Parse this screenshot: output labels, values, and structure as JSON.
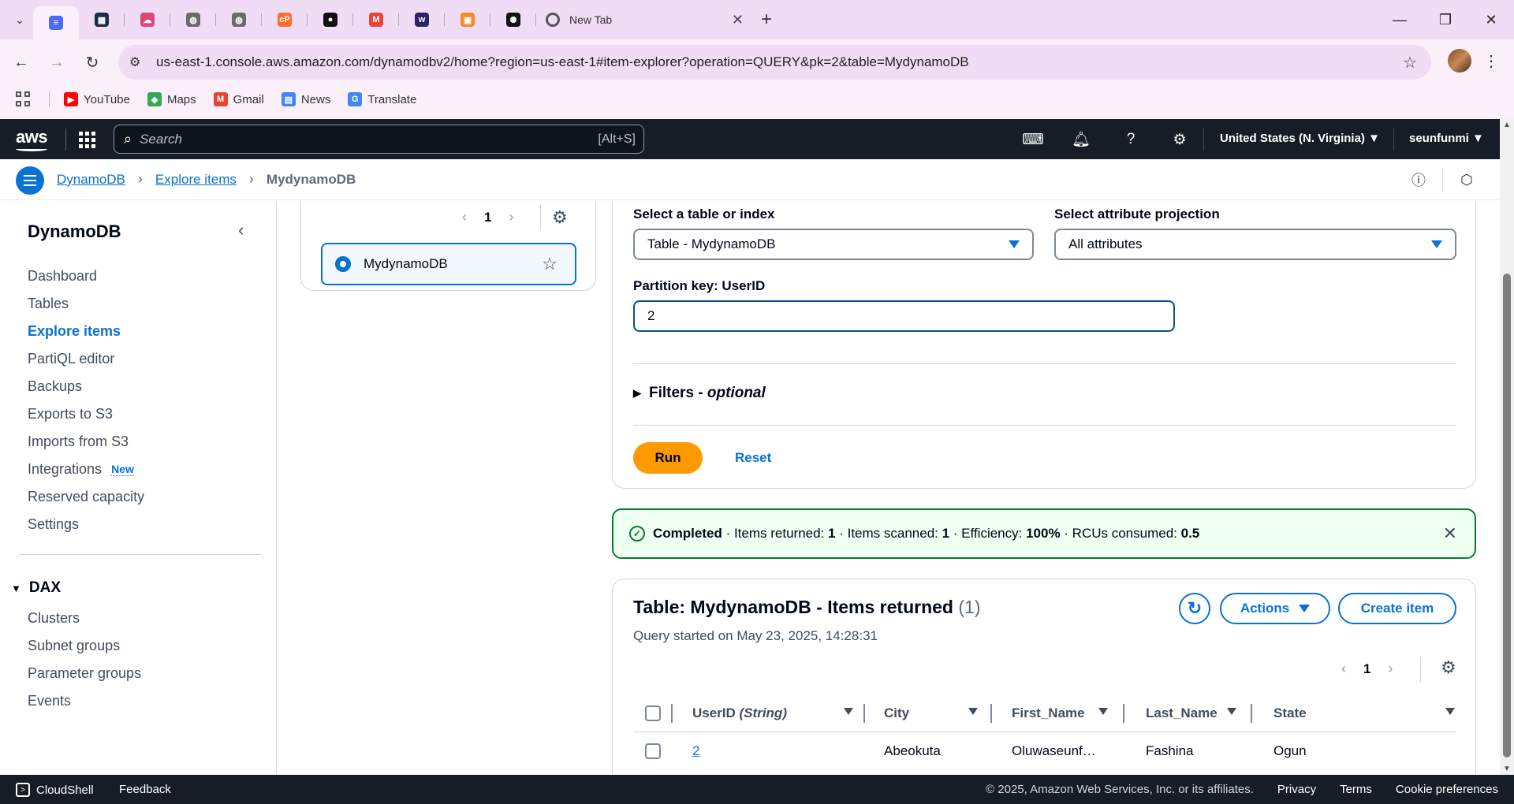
{
  "browser": {
    "tabs": [
      {
        "icon": "app-icon",
        "color": "#4a6cf7",
        "glyph": "≡"
      },
      {
        "icon": "cms-icon",
        "color": "#1d2b4a",
        "glyph": "▦"
      },
      {
        "icon": "cloud-icon",
        "color": "#e0457b",
        "glyph": "☁"
      },
      {
        "icon": "globe-icon",
        "color": "#6b6b6b",
        "glyph": "◍"
      },
      {
        "icon": "globe-icon",
        "color": "#6b6b6b",
        "glyph": "◍"
      },
      {
        "icon": "cpanel-icon",
        "color": "#ff6c2c",
        "glyph": "cP"
      },
      {
        "icon": "github-icon",
        "color": "#111111",
        "glyph": "●"
      },
      {
        "icon": "gmail-icon",
        "color": "#ea4335",
        "glyph": "M"
      },
      {
        "icon": "w-icon",
        "color": "#2b2366",
        "glyph": "w"
      },
      {
        "icon": "box-icon",
        "color": "#f28c28",
        "glyph": "▣"
      },
      {
        "icon": "openai-icon",
        "color": "#111111",
        "glyph": "✺"
      }
    ],
    "new_tab_title": "New Tab",
    "url": "us-east-1.console.aws.amazon.com/dynamodbv2/home?region=us-east-1#item-explorer?operation=QUERY&pk=2&table=MydynamoDB",
    "bookmarks": {
      "youtube": "YouTube",
      "maps": "Maps",
      "gmail": "Gmail",
      "news": "News",
      "translate": "Translate"
    }
  },
  "aws": {
    "logo": "aws",
    "search_placeholder": "Search",
    "search_shortcut": "[Alt+S]",
    "region": "United States (N. Virginia) ▼",
    "account": "seunfunmi ▼"
  },
  "breadcrumb": {
    "dynamodb": "DynamoDB",
    "explore": "Explore items",
    "current": "MydynamoDB"
  },
  "sidebar": {
    "title": "DynamoDB",
    "items": [
      {
        "label": "Dashboard"
      },
      {
        "label": "Tables"
      },
      {
        "label": "Explore items"
      },
      {
        "label": "PartiQL editor"
      },
      {
        "label": "Backups"
      },
      {
        "label": "Exports to S3"
      },
      {
        "label": "Imports from S3"
      },
      {
        "label": "Integrations"
      },
      {
        "label": "Reserved capacity"
      },
      {
        "label": "Settings"
      }
    ],
    "new_badge": "New",
    "dax_title": "DAX",
    "dax_items": [
      {
        "label": "Clusters"
      },
      {
        "label": "Subnet groups"
      },
      {
        "label": "Parameter groups"
      },
      {
        "label": "Events"
      }
    ]
  },
  "tables_panel": {
    "page": "1",
    "table_name": "MydynamoDB"
  },
  "query": {
    "table_label": "Select a table or index",
    "table_value": "Table - MydynamoDB",
    "projection_label": "Select attribute projection",
    "projection_value": "All attributes",
    "pk_label": "Partition key: UserID",
    "pk_value": "2",
    "filters_label": "Filters - ",
    "filters_optional": "optional",
    "run_label": "Run",
    "reset_label": "Reset"
  },
  "flash": {
    "status": "Completed",
    "items_returned_label": " · Items returned: ",
    "items_returned": "1",
    "items_scanned_label": " · Items scanned: ",
    "items_scanned": "1",
    "efficiency_label": " · Efficiency: ",
    "efficiency": "100%",
    "rcu_label": " · RCUs consumed: ",
    "rcu": "0.5"
  },
  "results": {
    "title": "Table: MydynamoDB - Items returned ",
    "count": "(1)",
    "subtitle": "Query started on May 23, 2025, 14:28:31",
    "actions_label": "Actions",
    "create_label": "Create item",
    "page": "1",
    "columns": {
      "userid": "UserID",
      "userid_type": "(String)",
      "city": "City",
      "first_name": "First_Name",
      "last_name": "Last_Name",
      "state": "State"
    },
    "rows": [
      {
        "userid": "2",
        "city": "Abeokuta",
        "first_name": "Oluwaseunf…",
        "last_name": "Fashina",
        "state": "Ogun"
      }
    ]
  },
  "footer": {
    "cloudshell": "CloudShell",
    "feedback": "Feedback",
    "copyright": "© 2025, Amazon Web Services, Inc. or its affiliates.",
    "privacy": "Privacy",
    "terms": "Terms",
    "cookies": "Cookie preferences"
  }
}
